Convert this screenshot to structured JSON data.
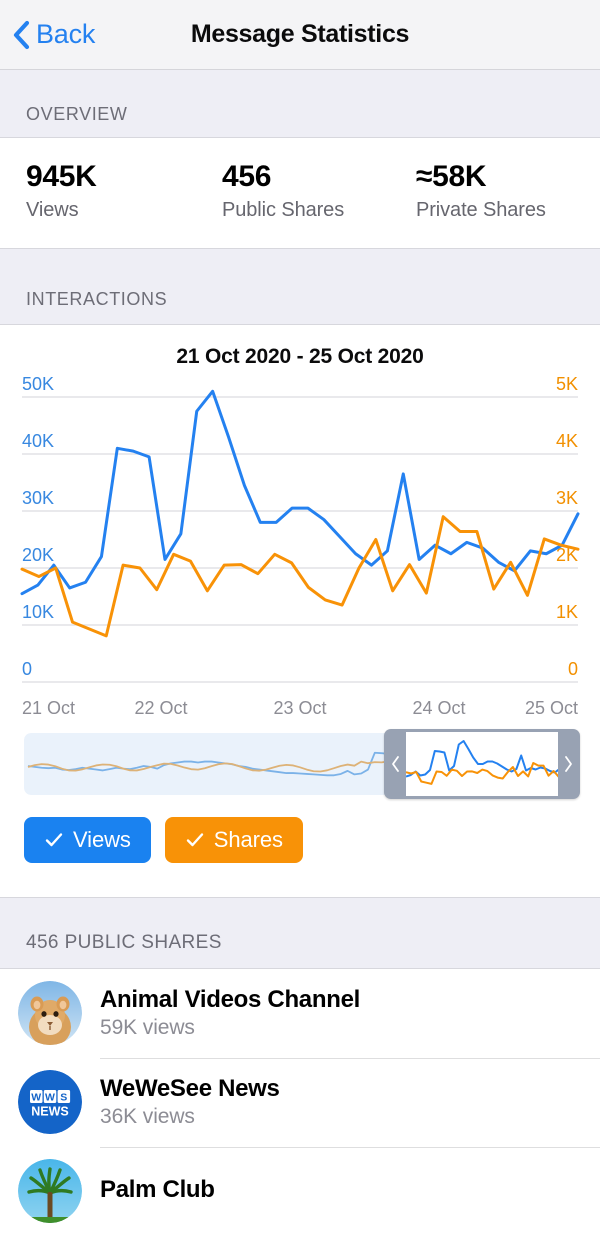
{
  "navbar": {
    "back_label": "Back",
    "title": "Message Statistics"
  },
  "overview": {
    "heading": "OVERVIEW",
    "stats": [
      {
        "value": "945K",
        "label": "Views"
      },
      {
        "value": "456",
        "label": "Public Shares"
      },
      {
        "value": "≈58K",
        "label": "Private Shares"
      }
    ]
  },
  "interactions": {
    "heading": "INTERACTIONS",
    "chart_title": "21 Oct 2020 - 25 Oct 2020",
    "filters": [
      {
        "label": "Views",
        "checked": true,
        "color": "#1a82f0"
      },
      {
        "label": "Shares",
        "checked": true,
        "color": "#f89207"
      }
    ]
  },
  "chart_data": {
    "type": "line",
    "title": "21 Oct 2020 - 25 Oct 2020",
    "xlabel": "",
    "grid": true,
    "legend_position": "below",
    "x_tick_labels": [
      "21 Oct",
      "22 Oct",
      "23 Oct",
      "24 Oct",
      "25 Oct"
    ],
    "left_axis": {
      "name": "Views",
      "color": "#3888e0",
      "ylim": [
        0,
        50000
      ],
      "tick_labels": [
        "0",
        "10K",
        "20K",
        "30K",
        "40K",
        "50K"
      ],
      "tick_values": [
        0,
        10000,
        20000,
        30000,
        40000,
        50000
      ]
    },
    "right_axis": {
      "name": "Shares",
      "color": "#f29000",
      "ylim": [
        0,
        5000
      ],
      "tick_labels": [
        "0",
        "1K",
        "2K",
        "3K",
        "4K",
        "5K"
      ],
      "tick_values": [
        0,
        1000,
        2000,
        3000,
        4000,
        5000
      ]
    },
    "series": [
      {
        "name": "Views",
        "axis": "left",
        "color": "#2481f0",
        "values": [
          15500,
          17000,
          20500,
          16500,
          17500,
          22000,
          41000,
          40500,
          39500,
          21500,
          26000,
          47500,
          51000,
          43000,
          34500,
          28000,
          28000,
          30500,
          30500,
          28500,
          25500,
          22500,
          20500,
          23000,
          36500,
          21500,
          24000,
          22500,
          24500,
          23500,
          21000,
          19500,
          23000,
          22500,
          24000,
          29500
        ]
      },
      {
        "name": "Shares",
        "axis": "right",
        "color": "#f89207",
        "values": [
          1980,
          1850,
          2000,
          1050,
          930,
          810,
          2050,
          2000,
          1620,
          2240,
          2120,
          1600,
          2050,
          2060,
          1900,
          2240,
          2090,
          1660,
          1440,
          1350,
          2000,
          2500,
          1600,
          2060,
          1560,
          2900,
          2640,
          2640,
          1630,
          2100,
          1520,
          2510,
          2400,
          2330
        ]
      }
    ]
  },
  "minimap": {
    "selection_start_pct": 66,
    "selection_end_pct": 100,
    "left_handle_icon": "chevron-left-icon",
    "right_handle_icon": "chevron-right-icon"
  },
  "public_shares": {
    "heading": "456 PUBLIC SHARES",
    "rows": [
      {
        "name": "Animal Videos Channel",
        "views": "59K views",
        "avatar": "lion-cub-photo"
      },
      {
        "name": "WeWeSee News",
        "views": "36K views",
        "avatar": "wws-news-logo"
      },
      {
        "name": "Palm Club",
        "views": "",
        "avatar": "palm-tree-photo"
      }
    ]
  },
  "colors": {
    "accent_blue": "#2481f0",
    "accent_orange": "#f89207",
    "section_bg": "#eeeef5",
    "navbar_bg": "#f4f4f6"
  }
}
